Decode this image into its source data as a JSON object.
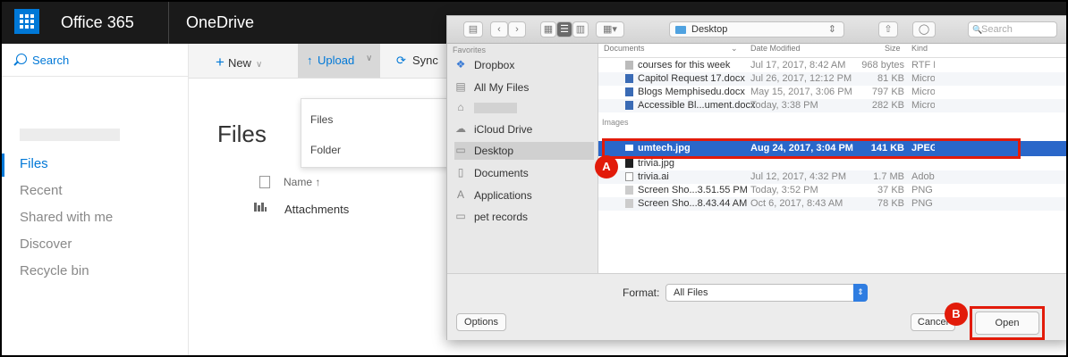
{
  "topbar": {
    "brand": "Office 365",
    "product": "OneDrive"
  },
  "leftnav": {
    "search_label": "Search",
    "items": [
      {
        "label": "Files",
        "active": true
      },
      {
        "label": "Recent"
      },
      {
        "label": "Shared with me"
      },
      {
        "label": "Discover"
      },
      {
        "label": "Recycle bin"
      }
    ]
  },
  "commandbar": {
    "new_label": "New",
    "upload_label": "Upload",
    "sync_label": "Sync"
  },
  "upload_menu": {
    "items": [
      "Files",
      "Folder"
    ]
  },
  "main": {
    "title": "Files",
    "col_name": "Name ↑",
    "rows": [
      {
        "name": "Attachments"
      }
    ]
  },
  "dialog": {
    "location": "Desktop",
    "search_placeholder": "Search",
    "sidebar": {
      "header": "Favorites",
      "items": [
        {
          "label": "Dropbox",
          "icon": "dropbox-icon"
        },
        {
          "label": "All My Files",
          "icon": "all-files-icon"
        },
        {
          "label": "",
          "icon": "user-icon",
          "redacted": true
        },
        {
          "label": "iCloud Drive",
          "icon": "cloud-icon"
        },
        {
          "label": "Desktop",
          "icon": "desktop-icon",
          "selected": true
        },
        {
          "label": "Documents",
          "icon": "documents-icon"
        },
        {
          "label": "Applications",
          "icon": "applications-icon"
        },
        {
          "label": "pet records",
          "icon": "folder-icon"
        }
      ]
    },
    "columns": {
      "name": "Documents",
      "date": "Date Modified",
      "size": "Size",
      "kind": "Kind"
    },
    "documents": [
      {
        "name": "courses for this week",
        "date": "Jul 17, 2017, 8:42 AM",
        "size": "968 bytes",
        "kind": "RTF D"
      },
      {
        "name": "Capitol Request 17.docx",
        "date": "Jul 26, 2017, 12:12 PM",
        "size": "81 KB",
        "kind": "Micro"
      },
      {
        "name": "Blogs Memphisedu.docx",
        "date": "May 15, 2017, 3:06 PM",
        "size": "797 KB",
        "kind": "Micro"
      },
      {
        "name": "Accessible Bl...ument.docx",
        "date": "Today, 3:38 PM",
        "size": "282 KB",
        "kind": "Micro"
      }
    ],
    "images_label": "Images",
    "images": [
      {
        "name": "umtech.jpg",
        "date": "Aug 24, 2017, 3:04 PM",
        "size": "141 KB",
        "kind": "JPEG",
        "selected": true
      },
      {
        "name": "trivia.jpg",
        "date": "",
        "size": "",
        "kind": ""
      },
      {
        "name": "trivia.ai",
        "date": "Jul 12, 2017, 4:32 PM",
        "size": "1.7 MB",
        "kind": "Adob"
      },
      {
        "name": "Screen Sho...3.51.55 PM",
        "date": "Today, 3:52 PM",
        "size": "37 KB",
        "kind": "PNG i"
      },
      {
        "name": "Screen Sho...8.43.44 AM",
        "date": "Oct 6, 2017, 8:43 AM",
        "size": "78 KB",
        "kind": "PNG i"
      }
    ],
    "format_label": "Format:",
    "format_value": "All Files",
    "options_label": "Options",
    "cancel_label": "Cancel",
    "open_label": "Open"
  },
  "annotations": {
    "a": "A",
    "b": "B",
    "color": "#e21b0a"
  }
}
